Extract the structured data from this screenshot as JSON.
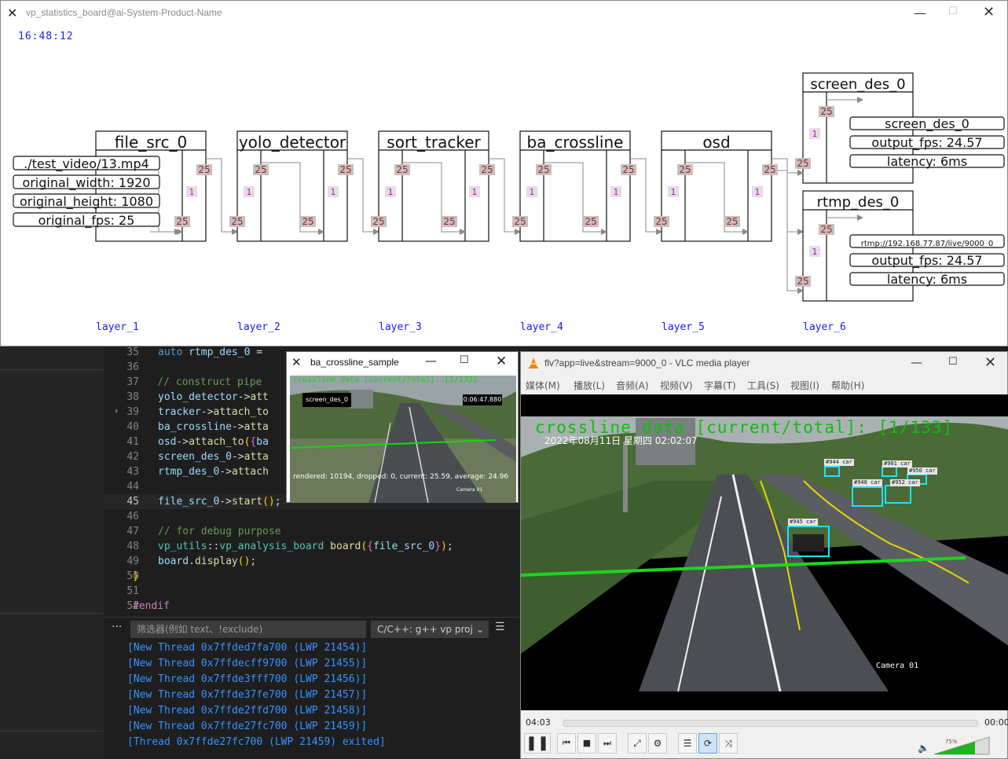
{
  "board": {
    "title": "vp_statistics_board@ai-System-Product-Name",
    "clock": "16:48:12",
    "layers": [
      "layer_1",
      "layer_2",
      "layer_3",
      "layer_4",
      "layer_5",
      "layer_6"
    ],
    "nodes": [
      {
        "name": "file_src_0",
        "in_queue": "25",
        "mid": "1",
        "out_queue": "25"
      },
      {
        "name": "yolo_detector",
        "in_queue": "25",
        "mid": "1",
        "out_queue": "25",
        "in_left": "25",
        "mid_left": "1",
        "out_left": "25"
      },
      {
        "name": "sort_tracker",
        "in_queue": "25",
        "mid": "1",
        "out_queue": "25",
        "in_left": "25",
        "mid_left": "1",
        "out_left": "25"
      },
      {
        "name": "ba_crossline",
        "in_queue": "25",
        "mid": "1",
        "out_queue": "25",
        "in_left": "25",
        "mid_left": "1",
        "out_left": "25"
      },
      {
        "name": "osd",
        "in_queue": "25",
        "mid": "1",
        "out_queue": "25",
        "in_left": "25",
        "mid_left": "1",
        "out_left": "25"
      }
    ],
    "src_info": [
      "./test_video/13.mp4",
      "original_width: 1920",
      "original_height: 1080",
      "original_fps: 25"
    ],
    "screen_des": {
      "name": "screen_des_0",
      "top_q": "25",
      "mid": "1",
      "bot_q": "25",
      "info": [
        "screen_des_0",
        "output_fps: 24.57",
        "latency: 6ms"
      ]
    },
    "rtmp_des": {
      "name": "rtmp_des_0",
      "top_q": "25",
      "mid": "1",
      "bot_q": "25",
      "info": [
        "rtmp://192.168.77.87/live/9000_0",
        "output_fps: 24.57",
        "latency: 6ms"
      ]
    }
  },
  "code": {
    "lines": [
      {
        "n": "35",
        "text": "    auto rtmp_des_0 = "
      },
      {
        "n": "36",
        "text": ""
      },
      {
        "n": "37",
        "text": "    // construct pipe"
      },
      {
        "n": "38",
        "text": "    yolo_detector->att"
      },
      {
        "n": "39",
        "text": "    tracker->attach_to"
      },
      {
        "n": "40",
        "text": "    ba_crossline->atta"
      },
      {
        "n": "41",
        "text": "    osd->attach_to({ba"
      },
      {
        "n": "42",
        "text": "    screen_des_0->atta"
      },
      {
        "n": "43",
        "text": "    rtmp_des_0->attach"
      },
      {
        "n": "44",
        "text": ""
      },
      {
        "n": "45",
        "text": "    file_src_0->start();"
      },
      {
        "n": "46",
        "text": ""
      },
      {
        "n": "47",
        "text": "    // for debug purpose"
      },
      {
        "n": "48",
        "text": "    vp_utils::vp_analysis_board board({file_src_0});"
      },
      {
        "n": "49",
        "text": "    board.display();"
      },
      {
        "n": "50",
        "text": "}"
      },
      {
        "n": "51",
        "text": ""
      },
      {
        "n": "52",
        "text": "#endif"
      }
    ]
  },
  "terminal": {
    "filter_placeholder": "筛选器(例如 text、!exclude)",
    "config_select": "C/C++: g++ vp proj",
    "lines": [
      "[New Thread 0x7ffded7fa700 (LWP 21454)]",
      "[New Thread 0x7ffdecff9700 (LWP 21455)]",
      "[New Thread 0x7ffde3fff700 (LWP 21456)]",
      "[New Thread 0x7ffde37fe700 (LWP 21457)]",
      "[New Thread 0x7ffde2ffd700 (LWP 21458)]",
      "[New Thread 0x7ffde27fc700 (LWP 21459)]",
      "[Thread 0x7ffde27fc700 (LWP 21459) exited]"
    ]
  },
  "crossline_window": {
    "title": "ba_crossline_sample",
    "header": "crossline data [current/total]: [1/133]",
    "timer": "0:06:47.880",
    "screen_label": "screen_des_0",
    "stats": "rendered: 10194, dropped: 0, current: 25.59, average: 24.96",
    "camera": "Camera 01"
  },
  "vlc": {
    "title": "flv?app=live&stream=9000_0 - VLC media player",
    "menu": [
      "媒体(M)",
      "播放(L)",
      "音频(A)",
      "视频(V)",
      "字幕(T)",
      "工具(S)",
      "视图(I)",
      "帮助(H)"
    ],
    "video_header": "crossline data [current/total]: [1/133]",
    "video_date": "2022年08月11日  星期四  02:02:07",
    "camera": "Camera 01",
    "cars": [
      "#944 car",
      "#901 car",
      "#950 car",
      "#948 car",
      "#952 car",
      "#945 car"
    ],
    "time_elapsed": "04:03",
    "time_total": "00:00",
    "volume": "75%",
    "accent": "#1ed41e"
  }
}
